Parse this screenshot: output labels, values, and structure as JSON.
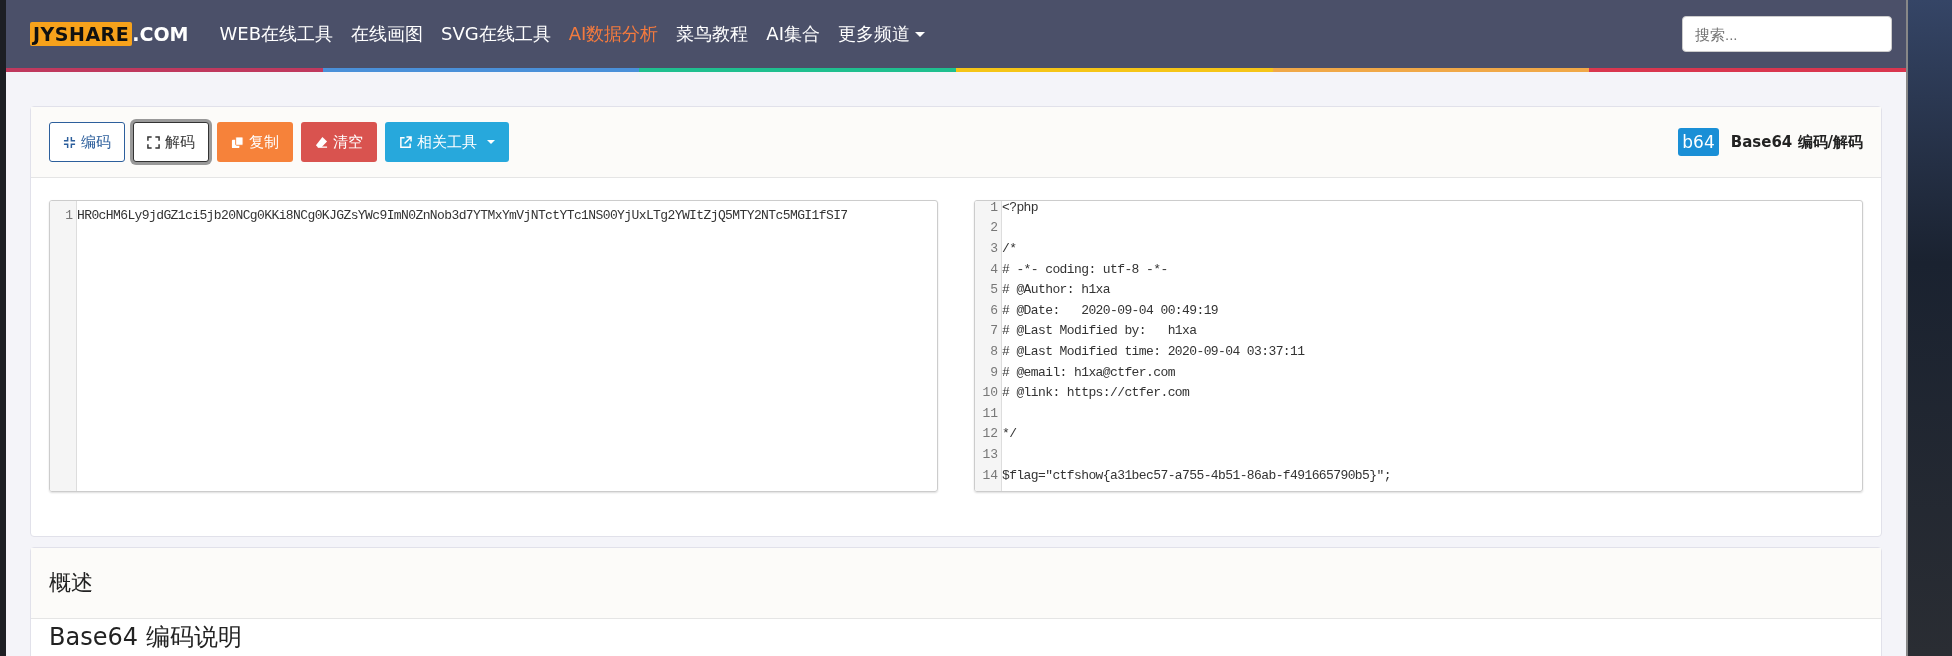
{
  "navbar": {
    "logo": {
      "box_text": "JYSHARE",
      "suffix": ".COM"
    },
    "items": [
      {
        "label": "WEB在线工具",
        "selected": false,
        "dropdown": false
      },
      {
        "label": "在线画图",
        "selected": false,
        "dropdown": false
      },
      {
        "label": "SVG在线工具",
        "selected": false,
        "dropdown": false
      },
      {
        "label": "AI数据分析",
        "selected": true,
        "dropdown": false
      },
      {
        "label": "菜鸟教程",
        "selected": false,
        "dropdown": false
      },
      {
        "label": "AI集合",
        "selected": false,
        "dropdown": false
      },
      {
        "label": "更多频道",
        "selected": false,
        "dropdown": true
      }
    ],
    "search": {
      "placeholder": "搜索..."
    }
  },
  "toolbar": {
    "buttons": [
      {
        "label": "编码",
        "kind": "outline-primary",
        "focused": false,
        "dropdown": false
      },
      {
        "label": "解码",
        "kind": "outline-dark",
        "focused": true,
        "dropdown": false
      },
      {
        "label": "复制",
        "kind": "warning",
        "focused": false,
        "dropdown": false
      },
      {
        "label": "清空",
        "kind": "danger",
        "focused": false,
        "dropdown": false
      },
      {
        "label": "相关工具",
        "kind": "info",
        "focused": false,
        "dropdown": true
      }
    ],
    "tool": {
      "badge": "b64",
      "title": "Base64 编码/解码"
    }
  },
  "input_editor": {
    "lines": [
      {
        "number": "1",
        "text": "HR0cHM6Ly9jdGZ1ci5jb20NCg0KKi8NCg0KJGZsYWc9ImN0ZnNob3d7YTMxYmVjNTctYTc1NS00YjUxLTg2YWItZjQ5MTY2NTc5MGI1fSI7"
      }
    ]
  },
  "output_editor": {
    "lines": [
      {
        "number": "1",
        "text": "<?php"
      },
      {
        "number": "2"
      },
      {
        "number": "3",
        "text": "/*"
      },
      {
        "number": "4",
        "text": "# -*- coding: utf-8 -*-"
      },
      {
        "number": "5",
        "text": "# @Author: h1xa"
      },
      {
        "number": "6",
        "text": "# @Date:   2020-09-04 00:49:19"
      },
      {
        "number": "7",
        "text": "# @Last Modified by:   h1xa"
      },
      {
        "number": "8",
        "text": "# @Last Modified time: 2020-09-04 03:37:11"
      },
      {
        "number": "9",
        "text": "# @email: h1xa@ctfer.com"
      },
      {
        "number": "10",
        "text": "# @link: https://ctfer.com"
      },
      {
        "number": "11"
      },
      {
        "number": "12",
        "text": "*/"
      },
      {
        "number": "13"
      },
      {
        "number": "14",
        "text": "$flag=\"ctfshow{a31bec57-a755-4b51-86ab-f491665790b5}\";"
      }
    ]
  },
  "overview": {
    "header": "概述",
    "heading": "Base64 编码说明"
  }
}
